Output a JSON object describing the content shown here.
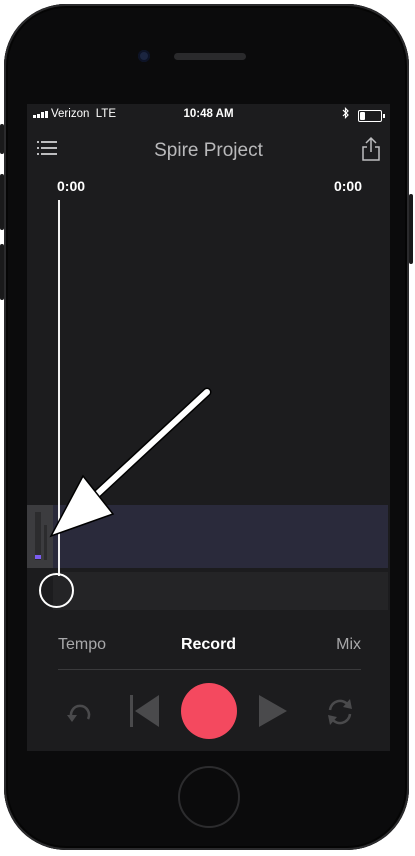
{
  "status_bar": {
    "carrier": "Verizon",
    "network": "LTE",
    "time": "10:48 AM",
    "bluetooth_icon": "bluetooth-icon",
    "battery_level": 0.25
  },
  "header": {
    "title": "Spire Project",
    "menu_icon": "menu-icon",
    "share_icon": "share-icon"
  },
  "timeline": {
    "current_time": "0:00",
    "total_time": "0:00"
  },
  "tabs": [
    {
      "label": "Tempo",
      "active": false
    },
    {
      "label": "Record",
      "active": true
    },
    {
      "label": "Mix",
      "active": false
    }
  ],
  "transport": {
    "undo_icon": "undo-icon",
    "prev_icon": "skip-back-icon",
    "record_icon": "record-icon",
    "play_icon": "play-icon",
    "loop_icon": "loop-icon"
  },
  "colors": {
    "record": "#f4495f",
    "meter": "#7b5cf0",
    "track": "#2a2a3b"
  }
}
